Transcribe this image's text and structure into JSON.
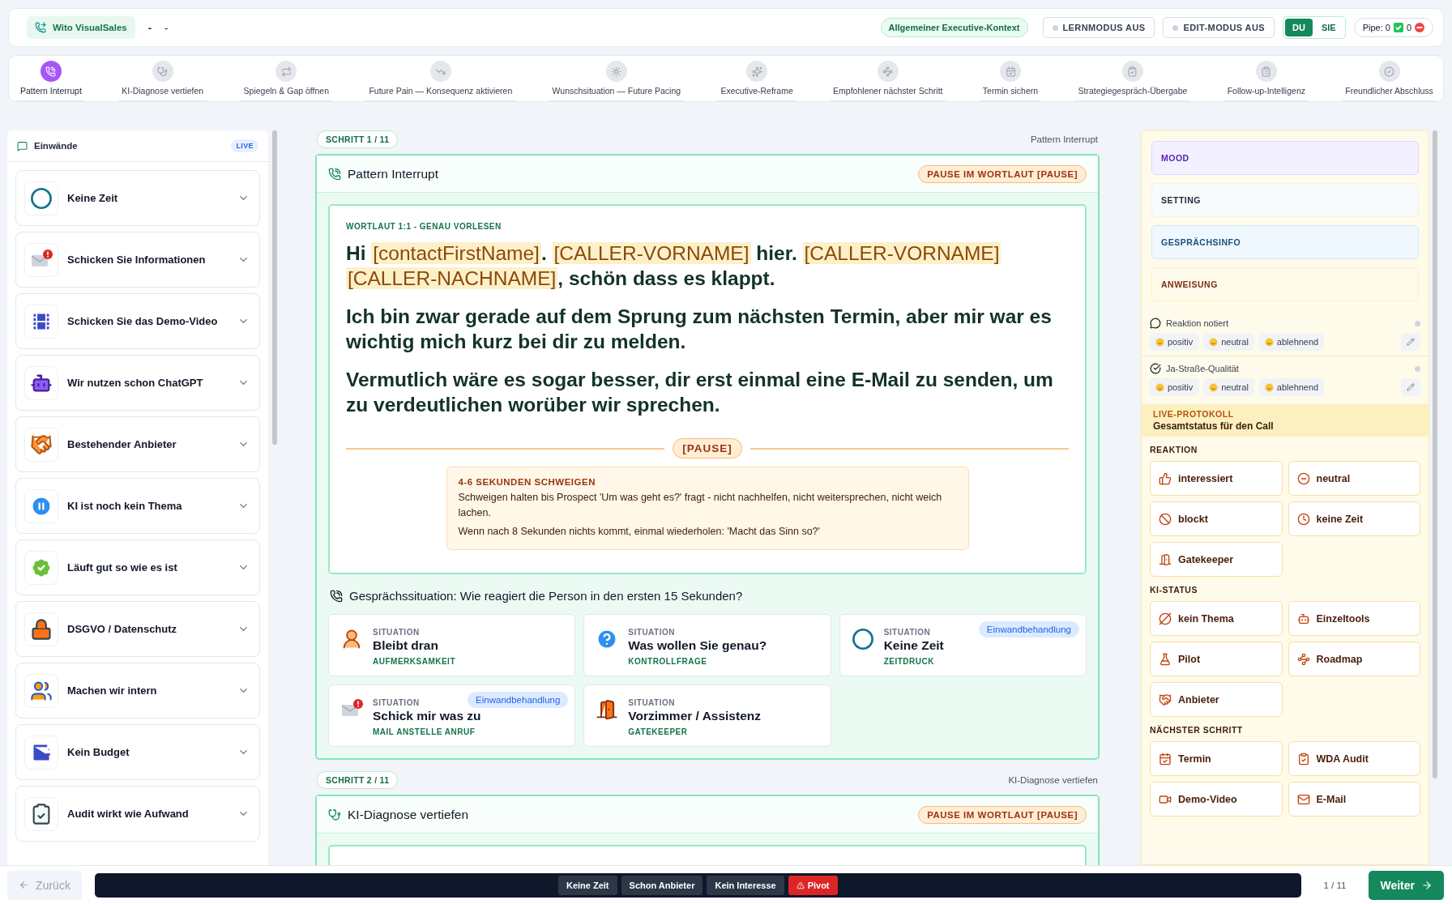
{
  "header": {
    "brand": "Wito VisualSales",
    "contact_name": "-",
    "contact_company": "-",
    "context_badge": "Allgemeiner Executive-Kontext",
    "toggles": [
      {
        "label": "LERNMODUS AUS",
        "on": false
      },
      {
        "label": "EDIT-MODUS AUS",
        "on": false
      }
    ],
    "address_mode": [
      {
        "label": "DU",
        "selected": true
      },
      {
        "label": "SIE",
        "selected": false
      }
    ],
    "pipe": {
      "label": "Pipe: 0",
      "count": "0"
    }
  },
  "steps": [
    {
      "label": "Pattern Interrupt",
      "selected": true
    },
    {
      "label": "KI-Diagnose vertiefen",
      "selected": false
    },
    {
      "label": "Spiegeln & Gap öffnen",
      "selected": false
    },
    {
      "label": "Future Pain — Konsequenz aktivieren",
      "selected": false
    },
    {
      "label": "Wunschsituation — Future Pacing",
      "selected": false
    },
    {
      "label": "Executive-Reframe",
      "selected": false
    },
    {
      "label": "Empfohlener nächster Schritt",
      "selected": false
    },
    {
      "label": "Termin sichern",
      "selected": false
    },
    {
      "label": "Strategiegespräch-Übergabe",
      "selected": false
    },
    {
      "label": "Follow-up-Intelligenz",
      "selected": false
    },
    {
      "label": "Freundlicher Abschluss",
      "selected": false
    }
  ],
  "objections": {
    "title": "Einwände",
    "badge": "LIVE",
    "items": [
      {
        "label": "Keine Zeit",
        "expanded": false
      },
      {
        "label": "Schicken Sie Informationen",
        "expanded": false
      },
      {
        "label": "Schicken Sie das Demo-Video",
        "expanded": false
      },
      {
        "label": "Wir nutzen schon ChatGPT",
        "expanded": false
      },
      {
        "label": "Bestehender Anbieter",
        "expanded": false
      },
      {
        "label": "KI ist noch kein Thema",
        "expanded": false
      },
      {
        "label": "Läuft gut so wie es ist",
        "expanded": false
      },
      {
        "label": "DSGVO / Datenschutz",
        "expanded": false
      },
      {
        "label": "Machen wir intern",
        "expanded": false
      },
      {
        "label": "Kein Budget",
        "expanded": false
      },
      {
        "label": "Audit wirkt wie Aufwand",
        "expanded": false
      }
    ]
  },
  "script_steps": [
    {
      "step": "SCHRITT 1 / 11",
      "name": "Pattern Interrupt",
      "title": "Pattern Interrupt",
      "badge": "PAUSE IM WORTLAUT [PAUSE]",
      "script_label": "WORTLAUT 1:1 - GENAU VORLESEN",
      "paragraphs": [
        [
          {
            "kind": "plain",
            "text": "Hi "
          },
          {
            "kind": "placeholder",
            "text": "[contactFirstName]"
          },
          {
            "kind": "plain",
            "text": ". "
          },
          {
            "kind": "placeholder",
            "text": "[CALLER-VORNAME]"
          },
          {
            "kind": "plain",
            "text": " hier. "
          },
          {
            "kind": "placeholder",
            "text": "[CALLER-VORNAME] "
          },
          {
            "kind": "placeholder",
            "text": "[CALLER-NACHNAME]"
          },
          {
            "kind": "plain",
            "text": ", schön dass es klappt."
          }
        ],
        [
          {
            "kind": "plain",
            "text": "Ich bin zwar gerade auf dem Sprung zum nächsten Termin, aber mir war es wichtig mich kurz bei dir zu melden."
          }
        ],
        [
          {
            "kind": "plain",
            "text": "Vermutlich wäre es sogar besser, dir erst einmal eine E-Mail zu senden, um zu verdeutlichen worüber wir sprechen."
          }
        ]
      ],
      "pause_label": "[PAUSE]",
      "pause_note": {
        "title": "4-6 SEKUNDEN SCHWEIGEN",
        "lines": [
          "Schweigen halten bis Prospect 'Um was geht es?' fragt - nicht nachhelfen, nicht weitersprechen, nicht weich lachen.",
          "Wenn nach 8 Sekunden nichts kommt, einmal wiederholen: 'Macht das Sinn so?'"
        ]
      },
      "situation": {
        "question": "Gesprächssituation: Wie reagiert die Person in den ersten 15 Sekunden?",
        "cards": [
          {
            "label": "SITUATION",
            "title": "Bleibt dran",
            "tag": "AUFMERKSAMKEIT"
          },
          {
            "label": "SITUATION",
            "title": "Was wollen Sie genau?",
            "tag": "KONTROLLFRAGE"
          },
          {
            "label": "SITUATION",
            "title": "Keine Zeit",
            "tag": "ZEITDRUCK",
            "badge": "Einwandbehandlung"
          },
          {
            "label": "SITUATION",
            "title": "Schick mir was zu",
            "tag": "MAIL ANSTELLE ANRUF",
            "badge": "Einwandbehandlung"
          },
          {
            "label": "SITUATION",
            "title": "Vorzimmer / Assistenz",
            "tag": "GATEKEEPER"
          }
        ]
      }
    },
    {
      "step": "SCHRITT 2 / 11",
      "name": "KI-Diagnose vertiefen",
      "title": "KI-Diagnose vertiefen",
      "badge": "PAUSE IM WORTLAUT [PAUSE]"
    }
  ],
  "side": {
    "fields": [
      {
        "label": "MOOD",
        "kind": "mood"
      },
      {
        "label": "SETTING",
        "kind": "setting"
      },
      {
        "label": "GESPRÄCHSINFO",
        "kind": "info"
      },
      {
        "label": "ANWEISUNG",
        "kind": "instruction"
      }
    ],
    "ratings": [
      {
        "label": "Reaktion notiert",
        "options": [
          "positiv",
          "neutral",
          "ablehnend"
        ]
      },
      {
        "label": "Ja-Straße-Qualität",
        "options": [
          "positiv",
          "neutral",
          "ablehnend"
        ]
      }
    ],
    "live": {
      "title": "LIVE-PROTOKOLL",
      "subtitle": "Gesamtstatus für den Call"
    },
    "groups": [
      {
        "title": "REAKTION",
        "options": [
          "interessiert",
          "neutral",
          "blockt",
          "keine Zeit",
          "Gatekeeper"
        ]
      },
      {
        "title": "KI-STATUS",
        "options": [
          "kein Thema",
          "Einzeltools",
          "Pilot",
          "Roadmap",
          "Anbieter"
        ]
      },
      {
        "title": "NÄCHSTER SCHRITT",
        "options": [
          "Termin",
          "WDA Audit",
          "Demo-Video",
          "E-Mail"
        ]
      }
    ]
  },
  "footer": {
    "back": {
      "label": "Zurück",
      "disabled": true
    },
    "quick_actions": [
      {
        "label": "Keine Zeit",
        "kind": "normal"
      },
      {
        "label": "Schon Anbieter",
        "kind": "normal"
      },
      {
        "label": "Kein Interesse",
        "kind": "normal"
      },
      {
        "label": "Pivot",
        "kind": "alert"
      }
    ],
    "counter": "1 / 11",
    "next": "Weiter"
  }
}
